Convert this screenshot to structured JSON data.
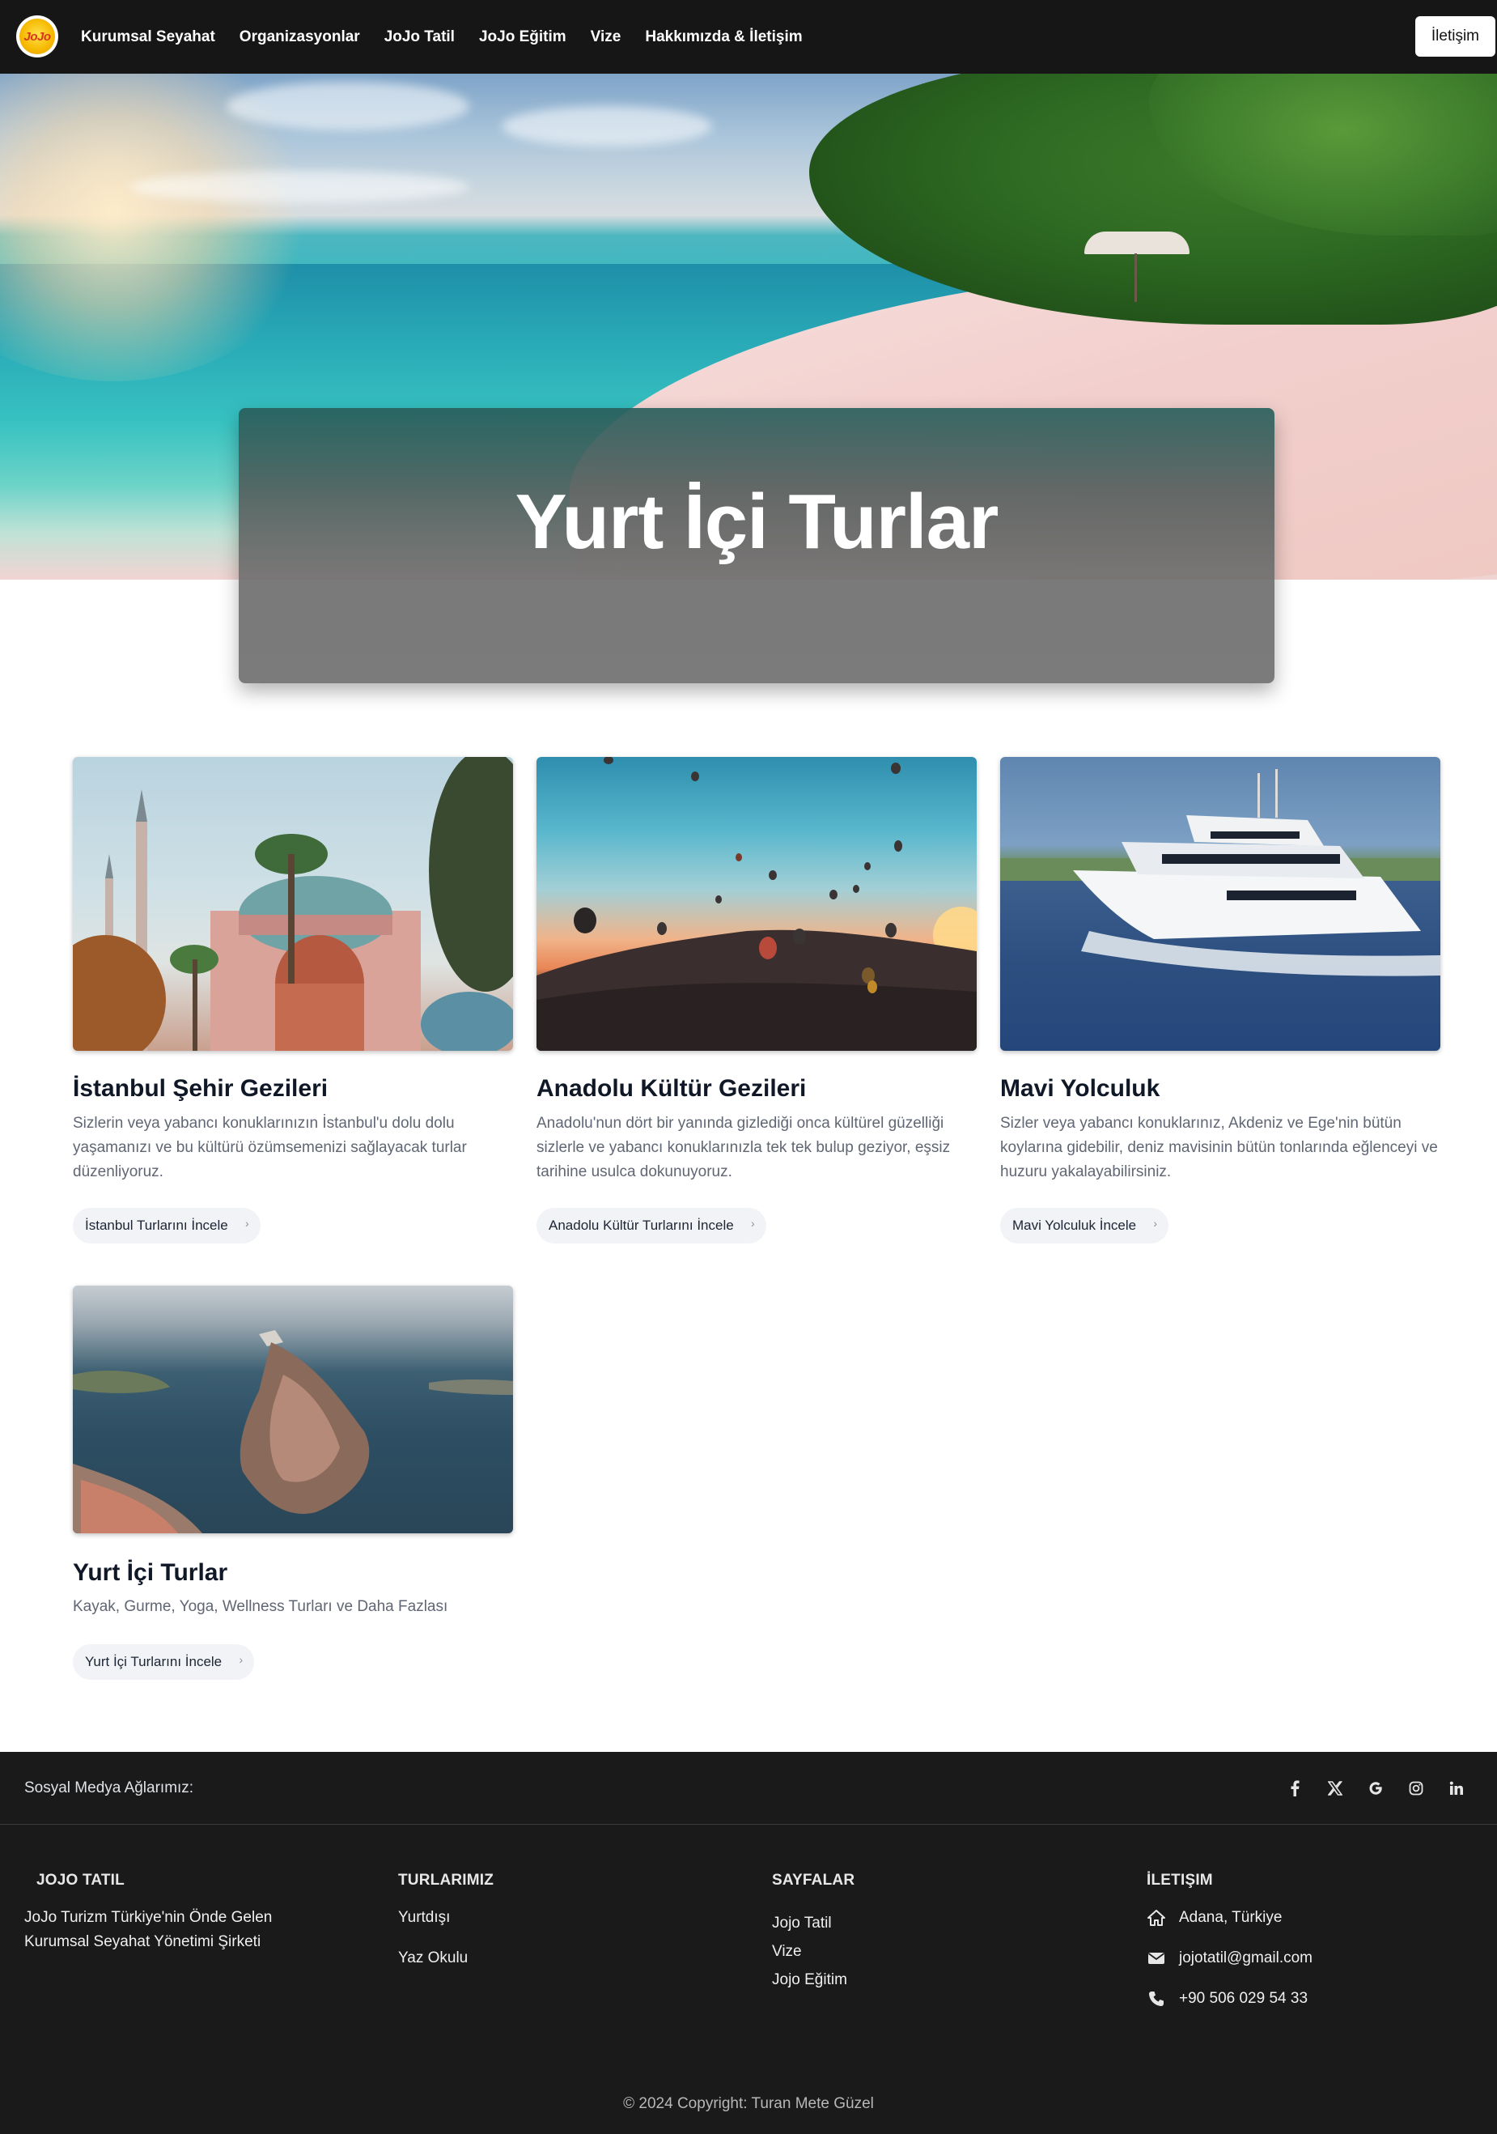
{
  "nav": {
    "logo_text": "JoJo",
    "links": [
      "Kurumsal Seyahat",
      "Organizasyonlar",
      "JoJo Tatil",
      "JoJo Eğitim",
      "Vize",
      "Hakkımızda & İletişim"
    ],
    "contact_button": "İletişim"
  },
  "hero": {
    "title": "Yurt İçi Turlar"
  },
  "cards": [
    {
      "title": "İstanbul Şehir Gezileri",
      "description": "Sizlerin veya yabancı konuklarınızın İstanbul'u dolu dolu yaşamanızı ve bu kültürü özümsemenizi sağlayacak turlar düzenliyoruz.",
      "button": "İstanbul Turlarını İncele"
    },
    {
      "title": "Anadolu Kültür Gezileri",
      "description": "Anadolu'nun dört bir yanında gizlediği onca kültürel güzelliği sizlerle ve yabancı konuklarınızla tek tek bulup geziyor, eşsiz tarihine usulca dokunuyoruz.",
      "button": "Anadolu Kültür Turlarını İncele"
    },
    {
      "title": "Mavi Yolculuk",
      "description": "Sizler veya yabancı konuklarınız, Akdeniz ve Ege'nin bütün koylarına gidebilir, deniz mavisinin bütün tonlarında eğlenceyi ve huzuru yakalayabilirsiniz.",
      "button": "Mavi Yolculuk İncele"
    },
    {
      "title": "Yurt İçi Turlar",
      "description": "Kayak, Gurme, Yoga, Wellness Turları ve Daha Fazlası",
      "button": "Yurt İçi Turlarını İncele"
    }
  ],
  "footer": {
    "social_label": "Sosyal Medya Ağlarımız:",
    "social_icons": [
      "facebook-icon",
      "x-icon",
      "google-icon",
      "instagram-icon",
      "linkedin-icon"
    ],
    "brand": {
      "heading": "JOJO TATIL",
      "text": "JoJo Turizm Türkiye'nin Önde Gelen Kurumsal Seyahat Yönetimi Şirketi"
    },
    "tours": {
      "heading": "TURLARIMIZ",
      "links": [
        "Yurtdışı",
        "Yaz Okulu"
      ]
    },
    "pages": {
      "heading": "SAYFALAR",
      "links": [
        "Jojo Tatil",
        "Vize",
        "Jojo Eğitim"
      ]
    },
    "contact": {
      "heading": "İLETIŞIM",
      "address": "Adana, Türkiye",
      "email": "jojotatil@gmail.com",
      "phone": "+90 506 029 54 33"
    },
    "copyright": "© 2024 Copyright: Turan Mete Güzel"
  }
}
